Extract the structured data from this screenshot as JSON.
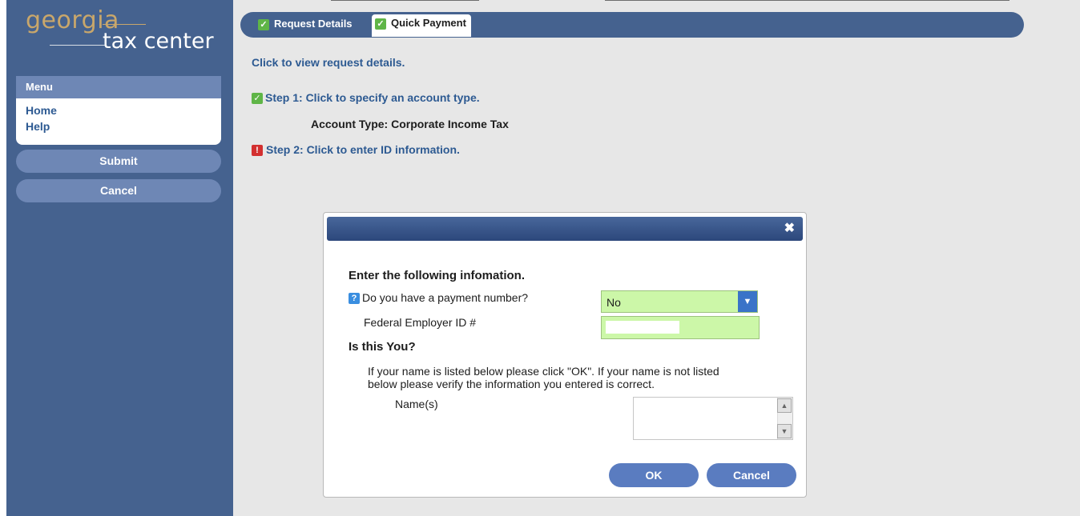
{
  "logo": {
    "line1": "georgia",
    "line2": "tax center"
  },
  "menu": {
    "title": "Menu",
    "items": [
      {
        "label": "Home"
      },
      {
        "label": "Help"
      }
    ]
  },
  "sidebar_buttons": {
    "submit": "Submit",
    "cancel": "Cancel"
  },
  "tabs": [
    {
      "label": "Request Details",
      "icon": "check-icon"
    },
    {
      "label": "Quick Payment",
      "icon": "check-icon",
      "active": true
    }
  ],
  "page": {
    "view_request_link": "Click to view request details.",
    "step1_link": "Step 1: Click to specify an account type.",
    "account_type": "Account Type: Corporate Income Tax",
    "step2_link": "Step 2: Click to enter ID information."
  },
  "dialog": {
    "close_icon": "close-icon",
    "heading": "Enter the following infomation.",
    "payment_question": "Do you have a payment number?",
    "payment_value": "No",
    "fein_label": "Federal Employer ID #",
    "is_you_heading": "Is this You?",
    "instructions": "If your name is listed below please click \"OK\". If your name is not listed below please verify the information you entered is correct.",
    "names_label": "Name(s)",
    "ok_label": "OK",
    "cancel_label": "Cancel"
  },
  "colors": {
    "sidebar": "#45628f",
    "accent": "#6e87b5",
    "link": "#2d5a92",
    "input_green": "#ccf7a8",
    "check_green": "#5fb547",
    "warn_red": "#d33030"
  }
}
